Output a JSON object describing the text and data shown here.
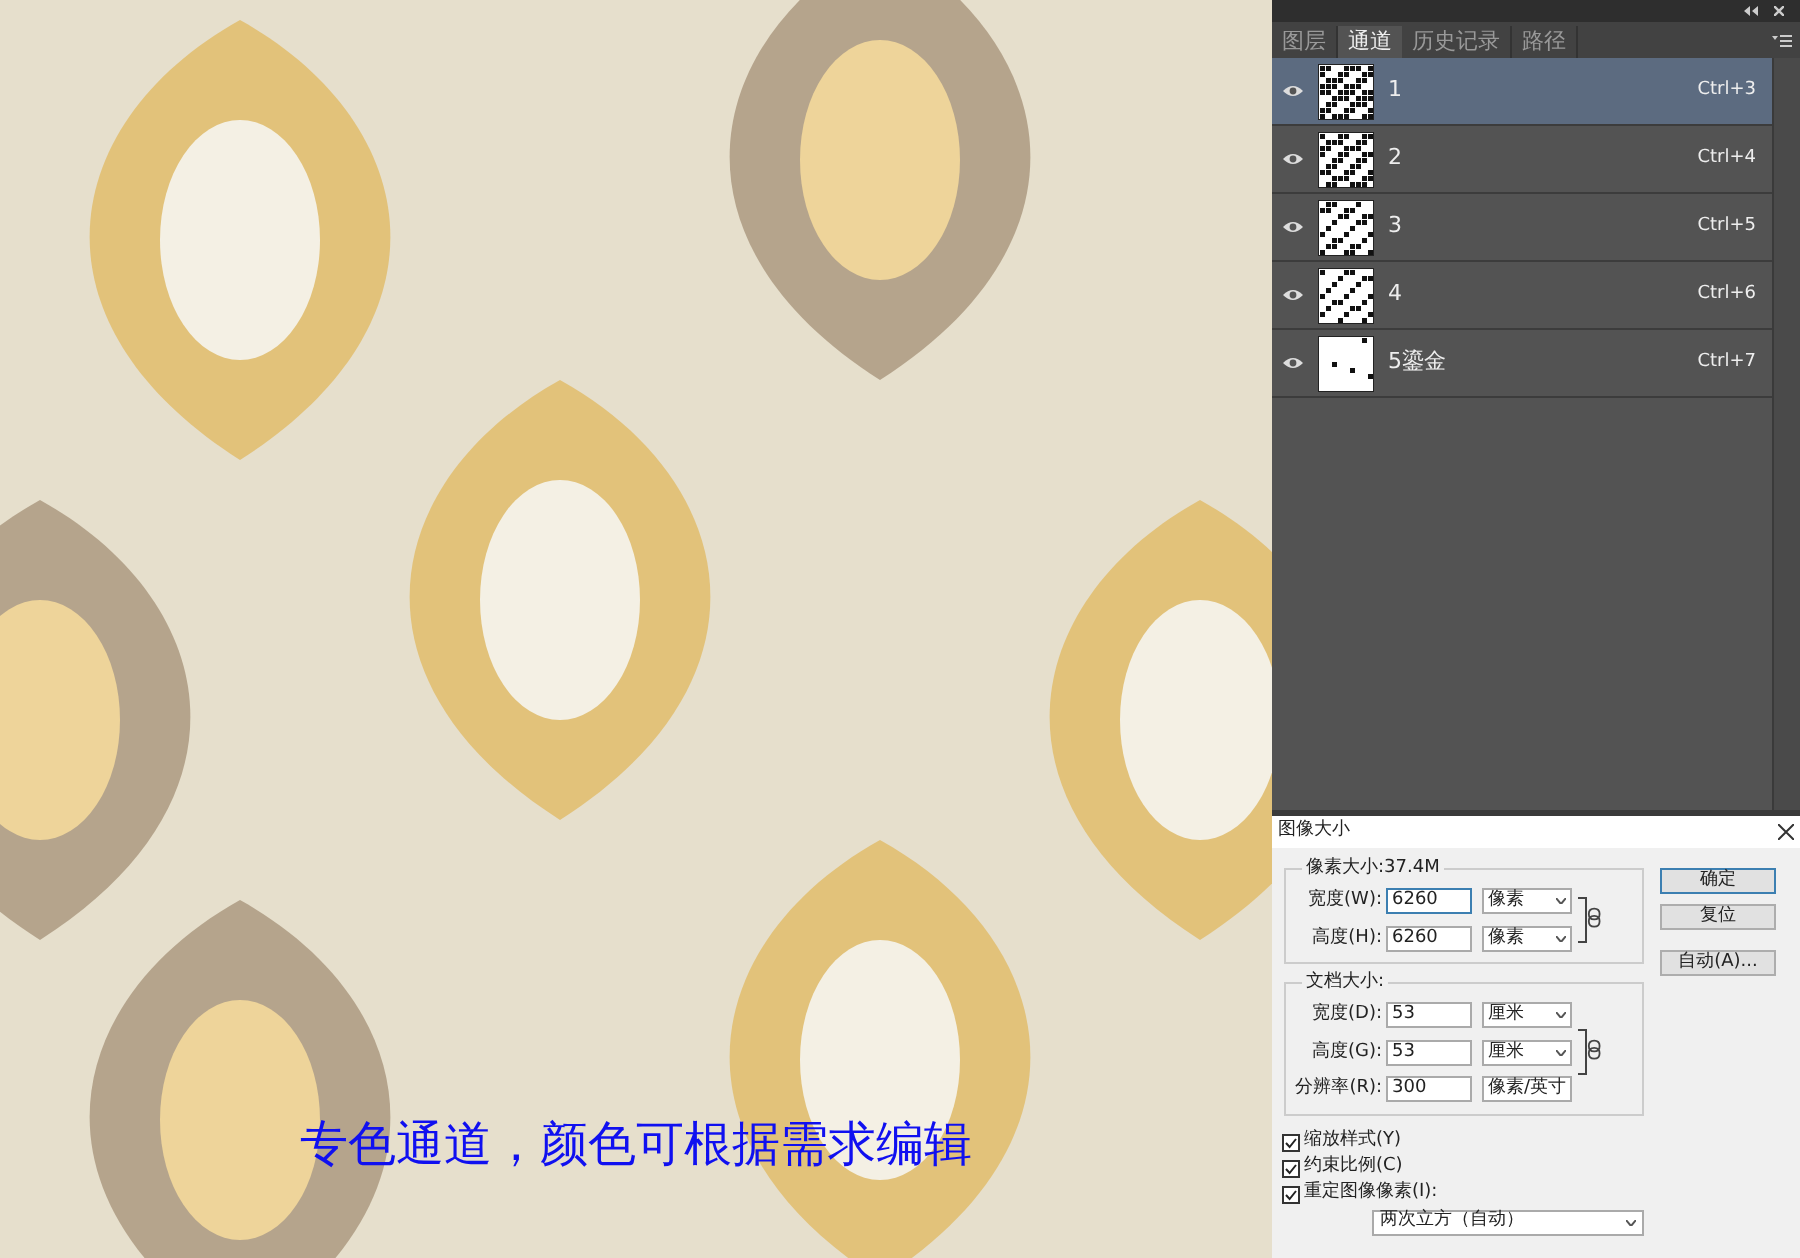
{
  "picture": {
    "kind": "picture",
    "caption": "专色通道，颜色可根据需求编辑"
  },
  "channels_panel": {
    "tabs": [
      {
        "label": "图层",
        "selected": false
      },
      {
        "label": "通道",
        "selected": true
      },
      {
        "label": "历史记录",
        "selected": false
      },
      {
        "label": "路径",
        "selected": false
      }
    ],
    "channels": [
      {
        "name": "1",
        "shortcut": "Ctrl+3",
        "visible": true,
        "selected": true
      },
      {
        "name": "2",
        "shortcut": "Ctrl+4",
        "visible": true,
        "selected": false
      },
      {
        "name": "3",
        "shortcut": "Ctrl+5",
        "visible": true,
        "selected": false
      },
      {
        "name": "4",
        "shortcut": "Ctrl+6",
        "visible": true,
        "selected": false
      },
      {
        "name": "5鎏金",
        "shortcut": "Ctrl+7",
        "visible": true,
        "selected": false
      }
    ]
  },
  "dialog": {
    "title": "图像大小",
    "pixel_group": {
      "title": "像素大小:37.4M",
      "fields": [
        {
          "label": "宽度(W):",
          "value": "6260",
          "unit": "像素"
        },
        {
          "label": "高度(H):",
          "value": "6260",
          "unit": "像素"
        }
      ]
    },
    "document_group": {
      "title": "文档大小:",
      "fields": [
        {
          "label": "宽度(D):",
          "value": "53",
          "unit": "厘米"
        },
        {
          "label": "高度(G):",
          "value": "53",
          "unit": "厘米"
        },
        {
          "label": "分辨率(R):",
          "value": "300",
          "unit": "像素/英寸"
        }
      ]
    },
    "buttons": [
      {
        "label": "确定",
        "default": true
      },
      {
        "label": "复位",
        "default": false
      },
      {
        "label": "自动(A)...",
        "default": false
      }
    ],
    "checkboxes": [
      {
        "label": "缩放样式(Y)",
        "checked": true
      },
      {
        "label": "约束比例(C)",
        "checked": true
      },
      {
        "label": "重定图像像素(I):",
        "checked": true
      }
    ],
    "resample_method": "两次立方（自动）"
  }
}
